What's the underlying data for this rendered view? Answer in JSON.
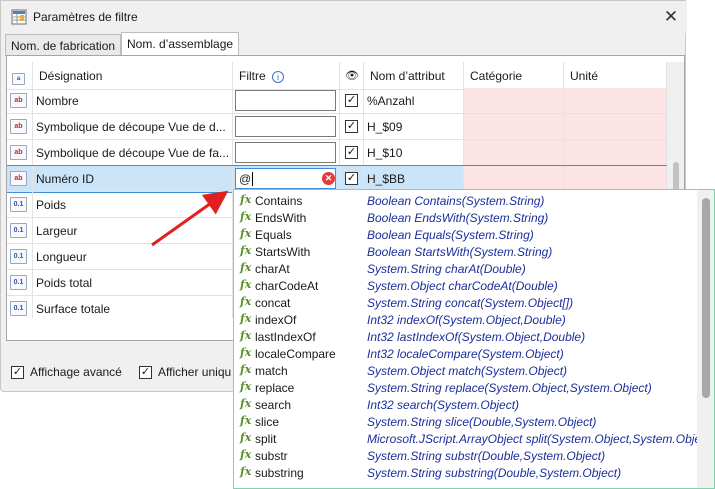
{
  "window": {
    "title": "Paramètres de filtre",
    "close": "✕"
  },
  "tabs": [
    "Nom. de fabrication",
    "Nom. d’assemblage"
  ],
  "grid": {
    "headers": {
      "designation": "Désignation",
      "filtre": "Filtre",
      "nom_attribut": "Nom d’attribut",
      "categorie": "Catégorie",
      "unite": "Unité"
    },
    "rows": [
      {
        "designation": "Nombre",
        "filter": "",
        "checked": true,
        "attr": "%Anzahl",
        "icon": "text-attribute-icon"
      },
      {
        "designation": "Symbolique de découpe Vue de d...",
        "filter": "",
        "checked": true,
        "attr": "H_$09",
        "icon": "text-attribute-icon"
      },
      {
        "designation": "Symbolique de découpe Vue de fa...",
        "filter": "",
        "checked": true,
        "attr": "H_$10",
        "icon": "text-attribute-icon"
      },
      {
        "designation": "Numéro ID",
        "filter": "@",
        "checked": true,
        "attr": "H_$BB",
        "icon": "text-attribute-icon"
      },
      {
        "designation": "Poids",
        "icon": "number-attribute-icon"
      },
      {
        "designation": "Largeur",
        "icon": "number-attribute-icon"
      },
      {
        "designation": "Longueur",
        "icon": "number-attribute-icon"
      },
      {
        "designation": "Poids total",
        "icon": "number-attribute-icon"
      },
      {
        "designation": "Surface totale",
        "icon": "number-attribute-icon"
      }
    ]
  },
  "options": {
    "affichage_avance": "Affichage avancé",
    "afficher_unique": "Afficher uniqu"
  },
  "autocomplete": [
    {
      "name": "Contains",
      "sig": "Boolean Contains(System.String)"
    },
    {
      "name": "EndsWith",
      "sig": "Boolean EndsWith(System.String)"
    },
    {
      "name": "Equals",
      "sig": "Boolean Equals(System.String)"
    },
    {
      "name": "StartsWith",
      "sig": "Boolean StartsWith(System.String)"
    },
    {
      "name": "charAt",
      "sig": "System.String charAt(Double)"
    },
    {
      "name": "charCodeAt",
      "sig": "System.Object charCodeAt(Double)"
    },
    {
      "name": "concat",
      "sig": "System.String concat(System.Object[])"
    },
    {
      "name": "indexOf",
      "sig": "Int32 indexOf(System.Object,Double)"
    },
    {
      "name": "lastIndexOf",
      "sig": "Int32 lastIndexOf(System.Object,Double)"
    },
    {
      "name": "localeCompare",
      "sig": "Int32 localeCompare(System.Object)"
    },
    {
      "name": "match",
      "sig": "System.Object match(System.Object)"
    },
    {
      "name": "replace",
      "sig": "System.String replace(System.Object,System.Object)"
    },
    {
      "name": "search",
      "sig": "Int32 search(System.Object)"
    },
    {
      "name": "slice",
      "sig": "System.String slice(Double,System.Object)"
    },
    {
      "name": "split",
      "sig": "Microsoft.JScript.ArrayObject split(System.Object,System.Object)"
    },
    {
      "name": "substr",
      "sig": "System.String substr(Double,System.Object)"
    },
    {
      "name": "substring",
      "sig": "System.String substring(Double,System.Object)"
    }
  ],
  "colors": {
    "accent": "#3f8ed8",
    "pink": "#fde4e4",
    "fx": "#5a8f2a",
    "signature": "#1b2e9c",
    "arrow": "#e02020"
  }
}
